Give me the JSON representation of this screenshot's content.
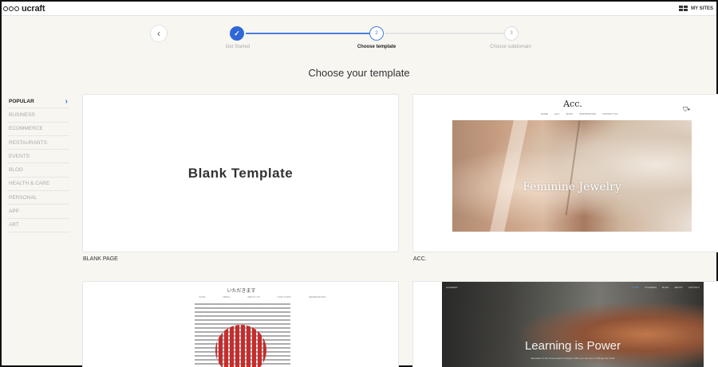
{
  "app": {
    "logo_text": "ucraft",
    "my_sites": "MY SITES"
  },
  "stepper": {
    "steps": [
      {
        "number": "1",
        "label": "Get Started",
        "status": "done"
      },
      {
        "number": "2",
        "label": "Choose template",
        "status": "current"
      },
      {
        "number": "3",
        "label": "Choose subdomain",
        "status": "todo"
      }
    ]
  },
  "page": {
    "heading": "Choose your template"
  },
  "categories": [
    "POPULAR",
    "BUSINESS",
    "ECOMMERCE",
    "RESTAURANTS",
    "EVENTS",
    "BLOG",
    "HEALTH & CARE",
    "PERSONAL",
    "APP",
    "ART"
  ],
  "templates": {
    "blank": {
      "preview_title": "Blank Template",
      "label": "BLANK PAGE"
    },
    "acc": {
      "label": "ACC.",
      "logo": "Acc.",
      "nav": [
        "HOME",
        "ACC",
        "SHOP",
        "INSPIRATIONS",
        "CONTACT US"
      ],
      "overlay_text": "Feminine Jewelry"
    },
    "jp": {
      "title": "いただきます",
      "nav": [
        "TOUR",
        "MENU",
        "ABOUT US",
        "OUR STORY",
        "RESERVATION"
      ]
    },
    "learn": {
      "brand": "ACADEMY",
      "nav": [
        "HOME",
        "COURSES",
        "BLOG",
        "ABOUT",
        "CONTACT"
      ],
      "title": "Learning is Power",
      "subtitle": "Education is the most powerful weapon which you can use to change the world"
    }
  },
  "colors": {
    "accent": "#2f67d7",
    "background": "#f7f6f1"
  }
}
